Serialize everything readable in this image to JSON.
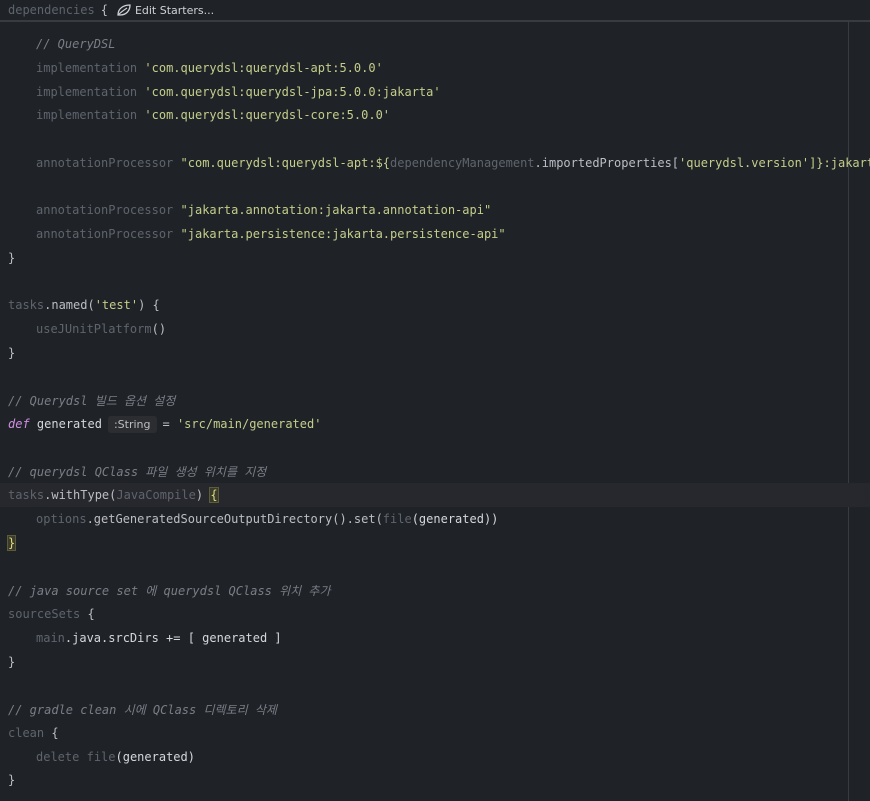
{
  "topbar": {
    "keyword": "dependencies",
    "brace": "{",
    "edit_starters_label": "Edit Starters..."
  },
  "code": {
    "l1_comment": "// QueryDSL",
    "l2_kw": "implementation",
    "l2_str": "'com.querydsl:querydsl-apt:5.0.0'",
    "l3_kw": "implementation",
    "l3_str": "'com.querydsl:querydsl-jpa:5.0.0:jakarta'",
    "l4_kw": "implementation",
    "l4_str": "'com.querydsl:querydsl-core:5.0.0'",
    "l5_kw": "annotationProcessor",
    "l5_str_a": "\"com.querydsl:querydsl-apt:${",
    "l5_dm": "dependencyManagement",
    "l5_mid": ".importedProperties[",
    "l5_key": "'querydsl.version'",
    "l5_end": "]}:jakarta\"",
    "l6_kw": "annotationProcessor",
    "l6_str": "\"jakarta.annotation:jakarta.annotation-api\"",
    "l7_kw": "annotationProcessor",
    "l7_str": "\"jakarta.persistence:jakarta.persistence-api\"",
    "close1": "}",
    "tasks_named_a": "tasks",
    "tasks_named_b": ".named(",
    "tasks_named_str": "'test'",
    "tasks_named_c": ") {",
    "use_junit": "useJUnitPlatform",
    "use_junit_paren": "()",
    "close2": "}",
    "comment_build": "// Querydsl 빌드 옵션 설정",
    "def_kw": "def",
    "def_name": "generated",
    "def_hint": ":String",
    "def_eq": "= ",
    "def_str": "'src/main/generated'",
    "comment_qclass": "// querydsl QClass 파일 생성 위치를 지정",
    "withtype_a": "tasks",
    "withtype_b": ".withType(",
    "withtype_c": "JavaCompile",
    "withtype_d": ") ",
    "withtype_brace": "{",
    "opts_a": "options",
    "opts_b": ".getGeneratedSourceOutputDirectory().set(",
    "opts_file": "file",
    "opts_c": "(generated))",
    "close3": "}",
    "comment_source": "// java source set 에 querydsl QClass 위치 추가",
    "sourcesets": "sourceSets",
    "sourcesets_brace": " {",
    "main_a": "main",
    "main_b": ".java.srcDirs += [ generated ]",
    "close4": "}",
    "comment_clean": "// gradle clean 시에 QClass 디렉토리 삭제",
    "clean": "clean",
    "clean_brace": " {",
    "delete_kw": "delete",
    "delete_file": "file",
    "delete_rest": "(generated)",
    "close5": "}"
  }
}
